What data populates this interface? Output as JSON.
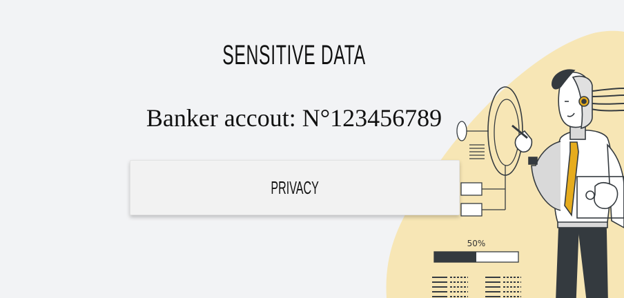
{
  "header": {
    "title": "SENSITIVE DATA"
  },
  "account": {
    "text": "Banker accout: N°123456789"
  },
  "actions": {
    "privacy_label": "PRIVACY"
  },
  "illustration": {
    "progress_label": "50%",
    "progress_value": 0.5,
    "icon": "robot-with-interface"
  },
  "colors": {
    "background": "#f2f3f5",
    "blob": "#f7e6b5",
    "accent": "#e6ac1e",
    "dark": "#343a3f"
  }
}
